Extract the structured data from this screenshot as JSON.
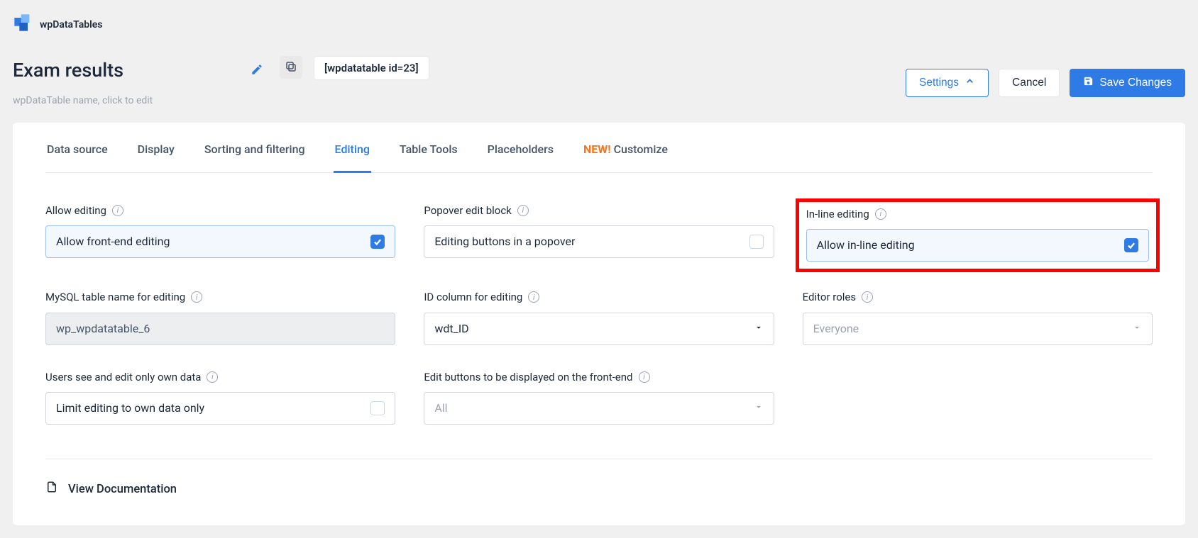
{
  "brand": {
    "name": "wpDataTables"
  },
  "header": {
    "title": "Exam results",
    "title_hint": "wpDataTable name, click to edit",
    "shortcode": "[wpdatatable id=23]",
    "settings_btn": "Settings",
    "cancel_btn": "Cancel",
    "save_btn": "Save Changes"
  },
  "tabs": [
    {
      "label": "Data source",
      "active": false
    },
    {
      "label": "Display",
      "active": false
    },
    {
      "label": "Sorting and filtering",
      "active": false
    },
    {
      "label": "Editing",
      "active": true
    },
    {
      "label": "Table Tools",
      "active": false
    },
    {
      "label": "Placeholders",
      "active": false
    },
    {
      "label": "Customize",
      "active": false,
      "new_prefix": "NEW! "
    }
  ],
  "form": {
    "allow_editing": {
      "label": "Allow editing",
      "text": "Allow front-end editing",
      "checked": true
    },
    "popover_block": {
      "label": "Popover edit block",
      "text": "Editing buttons in a popover",
      "checked": false
    },
    "inline_editing": {
      "label": "In-line editing",
      "text": "Allow in-line editing",
      "checked": true
    },
    "mysql_table": {
      "label": "MySQL table name for editing",
      "value": "wp_wpdatatable_6"
    },
    "id_column": {
      "label": "ID column for editing",
      "value": "wdt_ID"
    },
    "editor_roles": {
      "label": "Editor roles",
      "placeholder": "Everyone"
    },
    "own_data": {
      "label": "Users see and edit only own data",
      "text": "Limit editing to own data only",
      "checked": false
    },
    "edit_buttons": {
      "label": "Edit buttons to be displayed on the front-end",
      "value": "All"
    }
  },
  "footer": {
    "doc_link": "View Documentation"
  }
}
